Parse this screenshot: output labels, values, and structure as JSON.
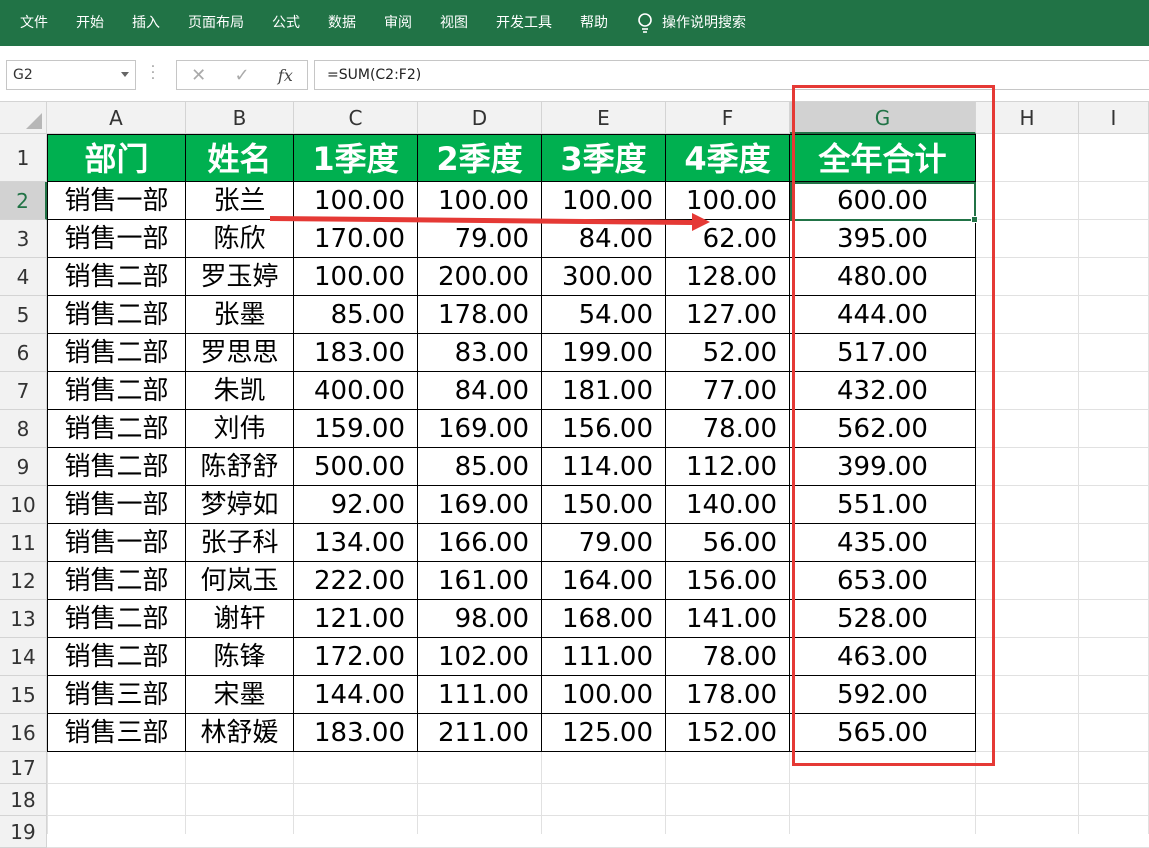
{
  "ribbon": {
    "tabs": [
      "文件",
      "开始",
      "插入",
      "页面布局",
      "公式",
      "数据",
      "审阅",
      "视图",
      "开发工具",
      "帮助"
    ],
    "tell_me": "操作说明搜索",
    "tell_me_icon": "lightbulb-icon"
  },
  "formula_bar": {
    "name_box": "G2",
    "cancel_icon": "✕",
    "enter_icon": "✓",
    "fx_label": "fx",
    "formula": "=SUM(C2:F2)"
  },
  "columns": [
    "A",
    "B",
    "C",
    "D",
    "E",
    "F",
    "G",
    "H",
    "I"
  ],
  "row_numbers": [
    "1",
    "2",
    "3",
    "4",
    "5",
    "6",
    "7",
    "8",
    "9",
    "10",
    "11",
    "12",
    "13",
    "14",
    "15",
    "16",
    "17",
    "18",
    "19"
  ],
  "selected_cell": "G2",
  "colors": {
    "header_fill": "#00b050",
    "ribbon": "#217346",
    "annotation": "#e53935"
  },
  "table": {
    "headers": [
      "部门",
      "姓名",
      "1季度",
      "2季度",
      "3季度",
      "4季度",
      "全年合计"
    ],
    "rows": [
      [
        "销售一部",
        "张兰",
        "100.00",
        "100.00",
        "100.00",
        "100.00",
        "600.00"
      ],
      [
        "销售一部",
        "陈欣",
        "170.00",
        "79.00",
        "84.00",
        "62.00",
        "395.00"
      ],
      [
        "销售二部",
        "罗玉婷",
        "100.00",
        "200.00",
        "300.00",
        "128.00",
        "480.00"
      ],
      [
        "销售二部",
        "张墨",
        "85.00",
        "178.00",
        "54.00",
        "127.00",
        "444.00"
      ],
      [
        "销售二部",
        "罗思思",
        "183.00",
        "83.00",
        "199.00",
        "52.00",
        "517.00"
      ],
      [
        "销售二部",
        "朱凯",
        "400.00",
        "84.00",
        "181.00",
        "77.00",
        "432.00"
      ],
      [
        "销售二部",
        "刘伟",
        "159.00",
        "169.00",
        "156.00",
        "78.00",
        "562.00"
      ],
      [
        "销售二部",
        "陈舒舒",
        "500.00",
        "85.00",
        "114.00",
        "112.00",
        "399.00"
      ],
      [
        "销售一部",
        "梦婷如",
        "92.00",
        "169.00",
        "150.00",
        "140.00",
        "551.00"
      ],
      [
        "销售一部",
        "张子科",
        "134.00",
        "166.00",
        "79.00",
        "56.00",
        "435.00"
      ],
      [
        "销售二部",
        "何岚玉",
        "222.00",
        "161.00",
        "164.00",
        "156.00",
        "653.00"
      ],
      [
        "销售二部",
        "谢轩",
        "121.00",
        "98.00",
        "168.00",
        "141.00",
        "528.00"
      ],
      [
        "销售二部",
        "陈锋",
        "172.00",
        "102.00",
        "111.00",
        "78.00",
        "463.00"
      ],
      [
        "销售三部",
        "宋墨",
        "144.00",
        "111.00",
        "100.00",
        "178.00",
        "592.00"
      ],
      [
        "销售三部",
        "林舒媛",
        "183.00",
        "211.00",
        "125.00",
        "152.00",
        "565.00"
      ]
    ]
  }
}
